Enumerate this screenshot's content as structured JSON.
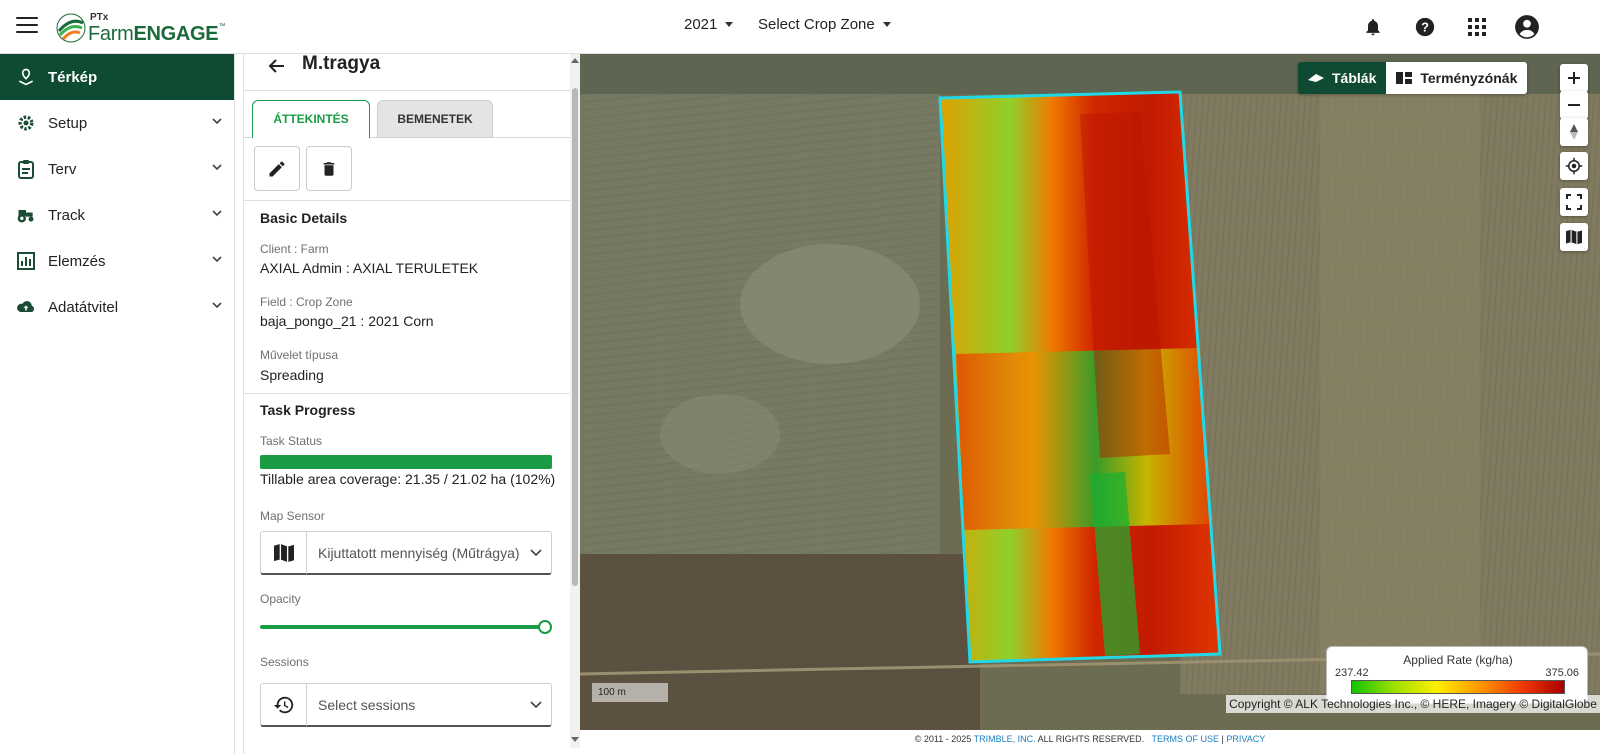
{
  "header": {
    "logo_ptx": "PTx",
    "logo_farm": "Farm",
    "logo_engage": "ENGAGE",
    "logo_tm": "™",
    "year": "2021",
    "crop_zone_select": "Select Crop Zone",
    "icons": [
      "menu-icon",
      "bell-icon",
      "help-icon",
      "apps-grid-icon",
      "account-icon"
    ]
  },
  "sidebar": {
    "items": [
      {
        "label": "Térkép",
        "icon": "map-pin-icon",
        "active": true
      },
      {
        "label": "Setup",
        "icon": "settings-gear-icon"
      },
      {
        "label": "Terv",
        "icon": "clipboard-icon"
      },
      {
        "label": "Track",
        "icon": "tractor-icon"
      },
      {
        "label": "Elemzés",
        "icon": "chart-icon"
      },
      {
        "label": "Adatátvitel",
        "icon": "cloud-upload-icon"
      }
    ]
  },
  "panel": {
    "title": "M.tragya",
    "tabs": [
      "ÁTTEKINTÉS",
      "BEMENETEK"
    ],
    "basic_details_title": "Basic Details",
    "client_label": "Client : Farm",
    "client_value": "AXIAL Admin : AXIAL TERULETEK",
    "field_label": "Field : Crop Zone",
    "field_value": "baja_pongo_21 : 2021 Corn",
    "operation_label": "Művelet típusa",
    "operation_value": "Spreading",
    "task_progress_title": "Task Progress",
    "task_status_label": "Task Status",
    "task_status_fill": 1.0,
    "coverage_text": "Tillable area coverage: 21.35 / 21.02 ha (102%)",
    "map_sensor_label": "Map Sensor",
    "map_sensor_value": "Kijuttatott mennyiség (Műtrágya) -",
    "opacity_label": "Opacity",
    "opacity_value": 1.0,
    "sessions_label": "Sessions",
    "sessions_placeholder": "Select sessions"
  },
  "map": {
    "layer_active": "Táblák",
    "layer_other": "Terményzónák",
    "legend_title": "Applied Rate (kg/ha)",
    "legend_min": "237.42",
    "legend_max": "375.06",
    "scale_label": "100 m",
    "copyright": "Copyright © ALK Technologies Inc., © HERE, Imagery © DigitalGlobe",
    "colors": {
      "boundary": "#22d8e6",
      "low": "#12c400",
      "high": "#a80000"
    }
  },
  "footer": {
    "text": "© 2011 - 2025",
    "company": "TRIMBLE, INC.",
    "rights": "ALL RIGHTS RESERVED.",
    "terms": "TERMS OF USE",
    "separator": "|",
    "privacy": "PRIVACY"
  }
}
